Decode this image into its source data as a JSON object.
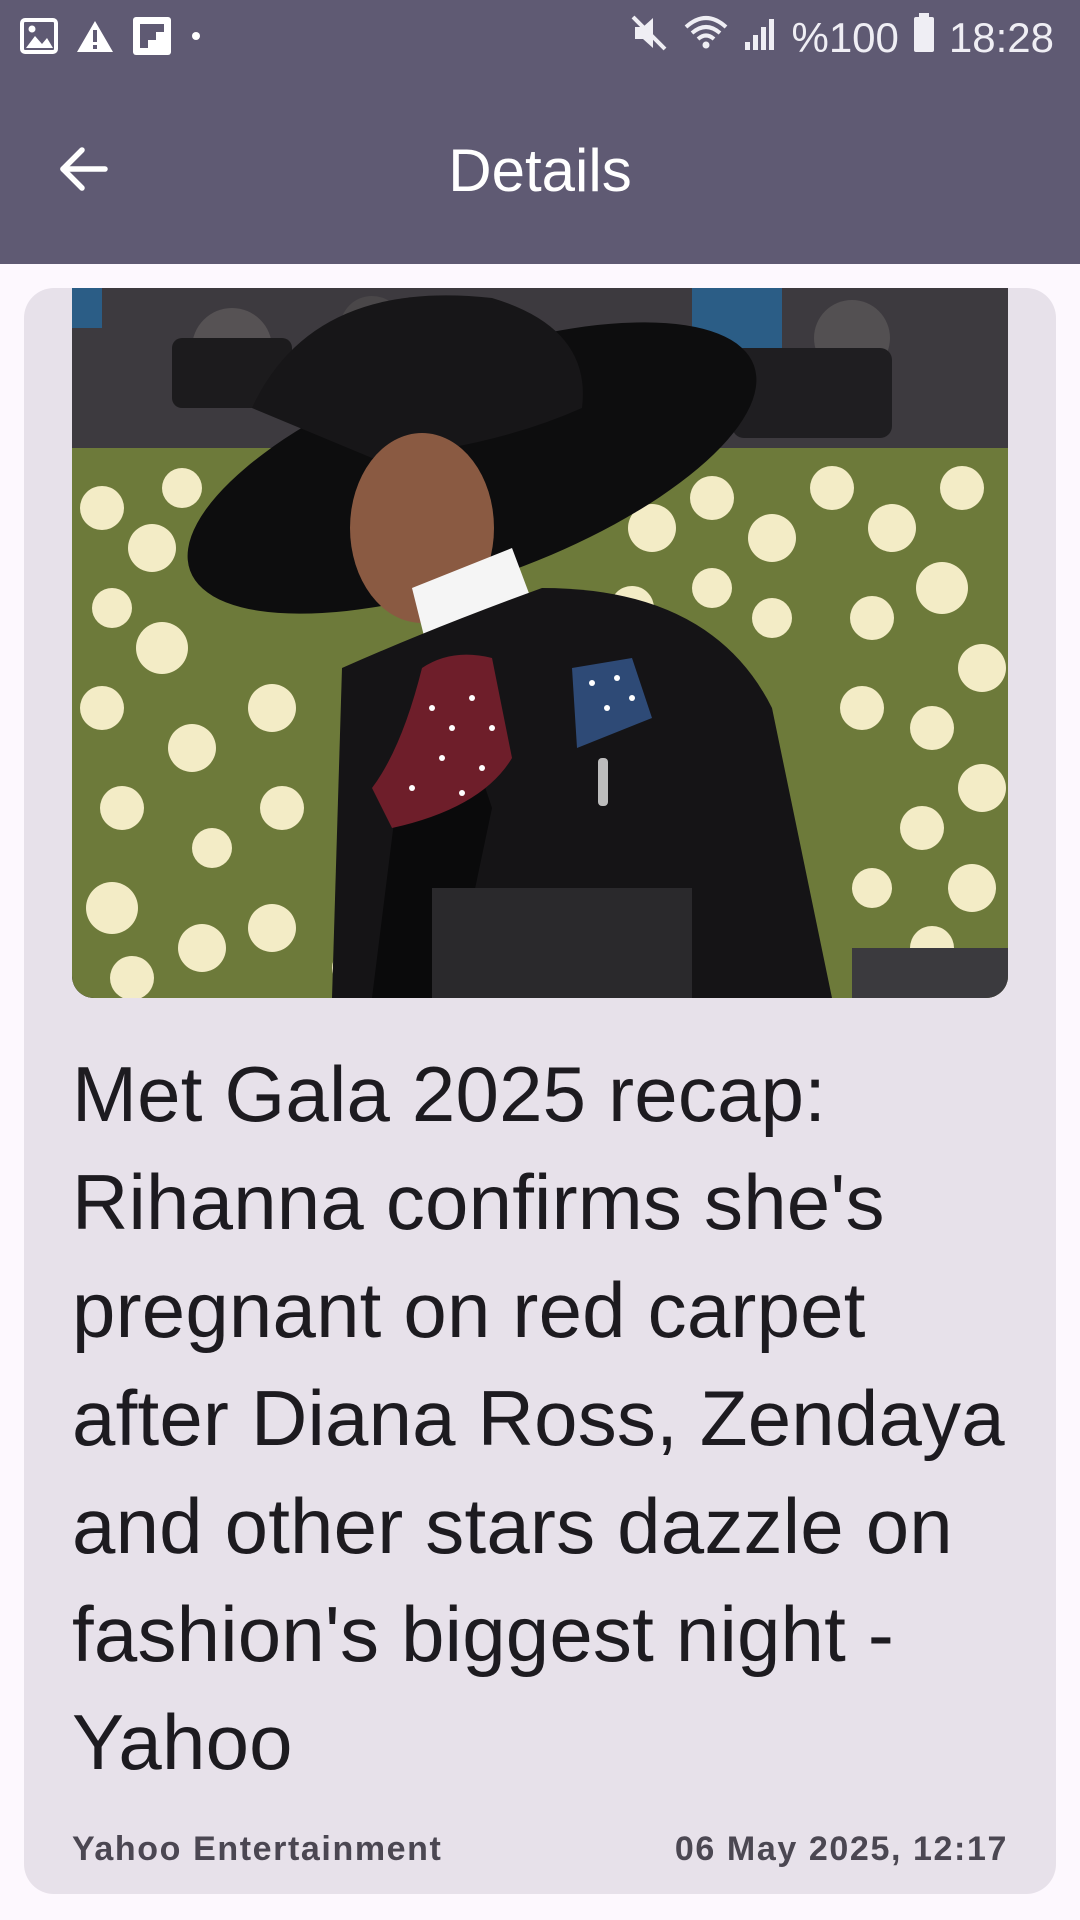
{
  "status_bar": {
    "icons_left": [
      "image-icon",
      "warning-icon",
      "flipboard-icon",
      "dot-icon"
    ],
    "icons_right": [
      "mute-icon",
      "wifi-icon",
      "signal-icon",
      "battery-icon"
    ],
    "battery": "%100",
    "time": "18:28"
  },
  "app_bar": {
    "back_icon": "arrow-left-icon",
    "title": "Details"
  },
  "article": {
    "image_description_icon": "article-photo",
    "title": "Met Gala 2025 recap: Rihanna confirms she's pregnant on red carpet after Diana Ross, Zendaya and other stars dazzle on fashion's biggest night - Yahoo",
    "source": "Yahoo Entertainment",
    "published": "06 May 2025, 12:17"
  },
  "colors": {
    "app_bar": "#5f5a73",
    "card": "#e7e1ea",
    "background": "#fdf8fe",
    "text": "#1d1b20"
  }
}
